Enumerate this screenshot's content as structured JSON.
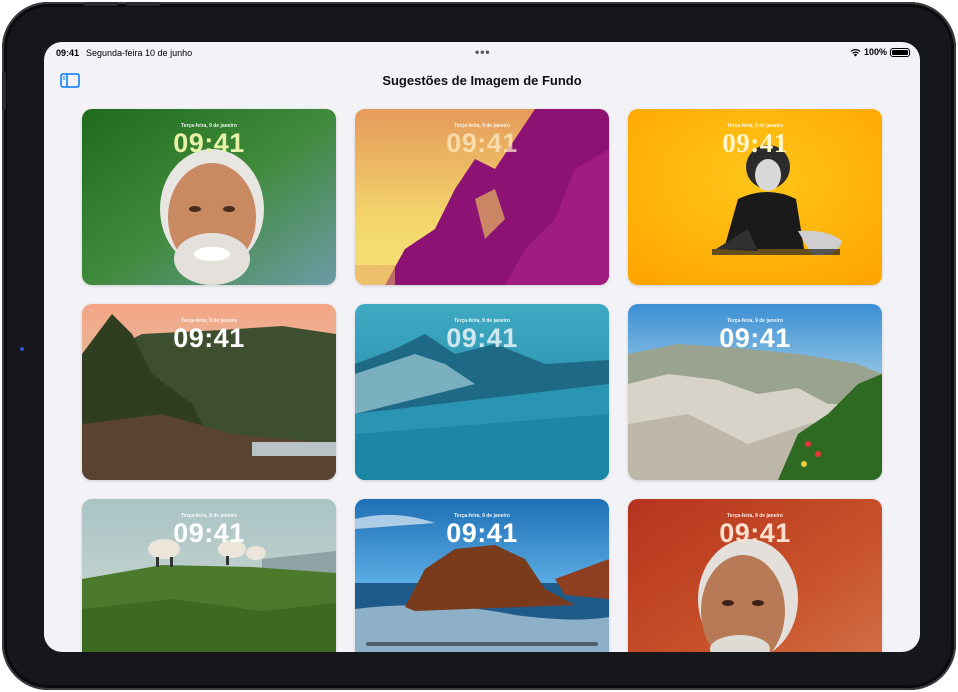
{
  "status_bar": {
    "time": "09:41",
    "date": "Segunda-feira 10 de junho",
    "dots": "•••",
    "battery": "100%"
  },
  "nav": {
    "title": "Sugestões de Imagem de Fundo"
  },
  "wallpapers": [
    {
      "date": "Terça-feira, 9 de janeiro",
      "time": "09:41"
    },
    {
      "date": "Terça-feira, 9 de janeiro",
      "time": "09:41"
    },
    {
      "date": "Terça-feira, 9 de janeiro",
      "time": "09:41"
    },
    {
      "date": "Terça-feira, 9 de janeiro",
      "time": "09:41"
    },
    {
      "date": "Terça-feira, 9 de janeiro",
      "time": "09:41"
    },
    {
      "date": "Terça-feira, 9 de janeiro",
      "time": "09:41"
    },
    {
      "date": "Terça-feira, 9 de janeiro",
      "time": "09:41"
    },
    {
      "date": "Terça-feira, 9 de janeiro",
      "time": "09:41"
    },
    {
      "date": "Terça-feira, 9 de janeiro",
      "time": "09:41"
    }
  ],
  "colors": {
    "accent": "#007aff",
    "screen_bg": "#f2f2f7"
  }
}
